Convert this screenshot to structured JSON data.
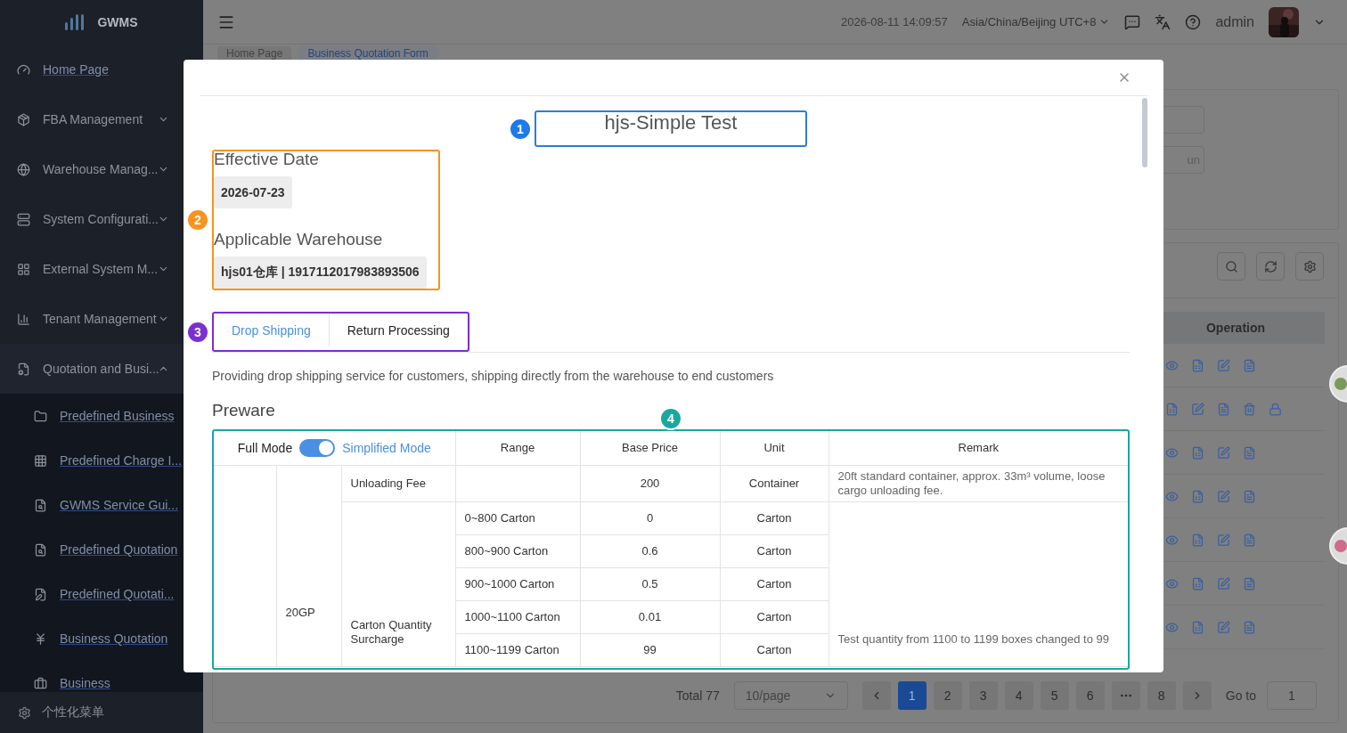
{
  "sidebar": {
    "logo": "GWMS",
    "items": [
      {
        "label": "Home Page",
        "kind": "link"
      },
      {
        "label": "FBA Management",
        "kind": "group",
        "expanded": false
      },
      {
        "label": "Warehouse Manag...",
        "kind": "group",
        "expanded": false
      },
      {
        "label": "System Configurati...",
        "kind": "group",
        "expanded": false
      },
      {
        "label": "External System M...",
        "kind": "group",
        "expanded": false
      },
      {
        "label": "Tenant Management",
        "kind": "group",
        "expanded": false
      },
      {
        "label": "Quotation and Busi...",
        "kind": "group",
        "expanded": true,
        "children": [
          {
            "label": "Predefined Business"
          },
          {
            "label": "Predefined Charge I..."
          },
          {
            "label": "GWMS Service Gui..."
          },
          {
            "label": "Predefined Quotation"
          },
          {
            "label": "Predefined Quotati..."
          },
          {
            "label": "Business Quotation"
          },
          {
            "label": "Business"
          }
        ]
      }
    ],
    "footer": "个性化菜单"
  },
  "header": {
    "datetime": "2026-08-11 14:09:57",
    "timezone": "Asia/China/Beijing UTC+8",
    "user": "admin"
  },
  "page_tabs": [
    {
      "label": "Home Page",
      "selected": false
    },
    {
      "label": "Business Quotation Form",
      "selected": true
    }
  ],
  "background": {
    "field_value": "un",
    "table": {
      "columns": [
        "Operation"
      ],
      "rows": [
        {
          "kind": "viewable"
        },
        {
          "kind": "lockable"
        },
        {
          "kind": "viewable"
        },
        {
          "kind": "viewable"
        },
        {
          "kind": "viewable"
        },
        {
          "kind": "viewable"
        },
        {
          "kind": "viewable"
        }
      ]
    },
    "pagination": {
      "total": "Total 77",
      "page_size": "10/page",
      "pages": [
        {
          "label": "1",
          "selected": true
        },
        {
          "label": "2",
          "selected": false
        },
        {
          "label": "3",
          "selected": false
        },
        {
          "label": "4",
          "selected": false
        },
        {
          "label": "5",
          "selected": false
        },
        {
          "label": "6",
          "selected": false
        },
        {
          "kind": "more",
          "selected": false
        },
        {
          "label": "8",
          "selected": false
        }
      ],
      "goto_label": "Go to",
      "goto_value": "1"
    }
  },
  "modal": {
    "title": "hjs-Simple Test",
    "title_marker": "1",
    "fields_marker": "2",
    "fields": [
      {
        "label": "Effective Date",
        "value": "2026-07-23"
      },
      {
        "label": "Applicable Warehouse",
        "value": "hjs01仓库 | 1917112017983893506"
      }
    ],
    "tabs_marker": "3",
    "tabs": [
      {
        "label": "Drop Shipping",
        "selected": true
      },
      {
        "label": "Return Processing",
        "selected": false
      }
    ],
    "description": "Providing drop shipping service for customers, shipping directly from the warehouse to end customers",
    "section_title": "Preware",
    "table_marker": "4",
    "table": {
      "mode_switch": {
        "left": "Full Mode",
        "right": "Simplified Mode",
        "on": true
      },
      "columns": [
        "Range",
        "Base Price",
        "Unit",
        "Remark"
      ],
      "container": "20GP",
      "groups": [
        {
          "name": "Unloading Fee",
          "remark": "20ft standard container, approx. 33m³ volume, loose cargo unloading fee.",
          "rows": [
            {
              "price": "200",
              "unit": "Container"
            }
          ]
        },
        {
          "name": "Carton Quantity Surcharge",
          "remark": "Test quantity from 1100 to 1199 boxes changed to 99",
          "rows": [
            {
              "range": "0~800 Carton",
              "price": "0",
              "unit": "Carton"
            },
            {
              "range": "800~900 Carton",
              "price": "0.6",
              "unit": "Carton"
            },
            {
              "range": "900~1000 Carton",
              "price": "0.5",
              "unit": "Carton"
            },
            {
              "range": "1000~1100 Carton",
              "price": "0.01",
              "unit": "Carton"
            },
            {
              "range": "1100~1199 Carton",
              "price": "99",
              "unit": "Carton"
            }
          ]
        }
      ]
    }
  }
}
